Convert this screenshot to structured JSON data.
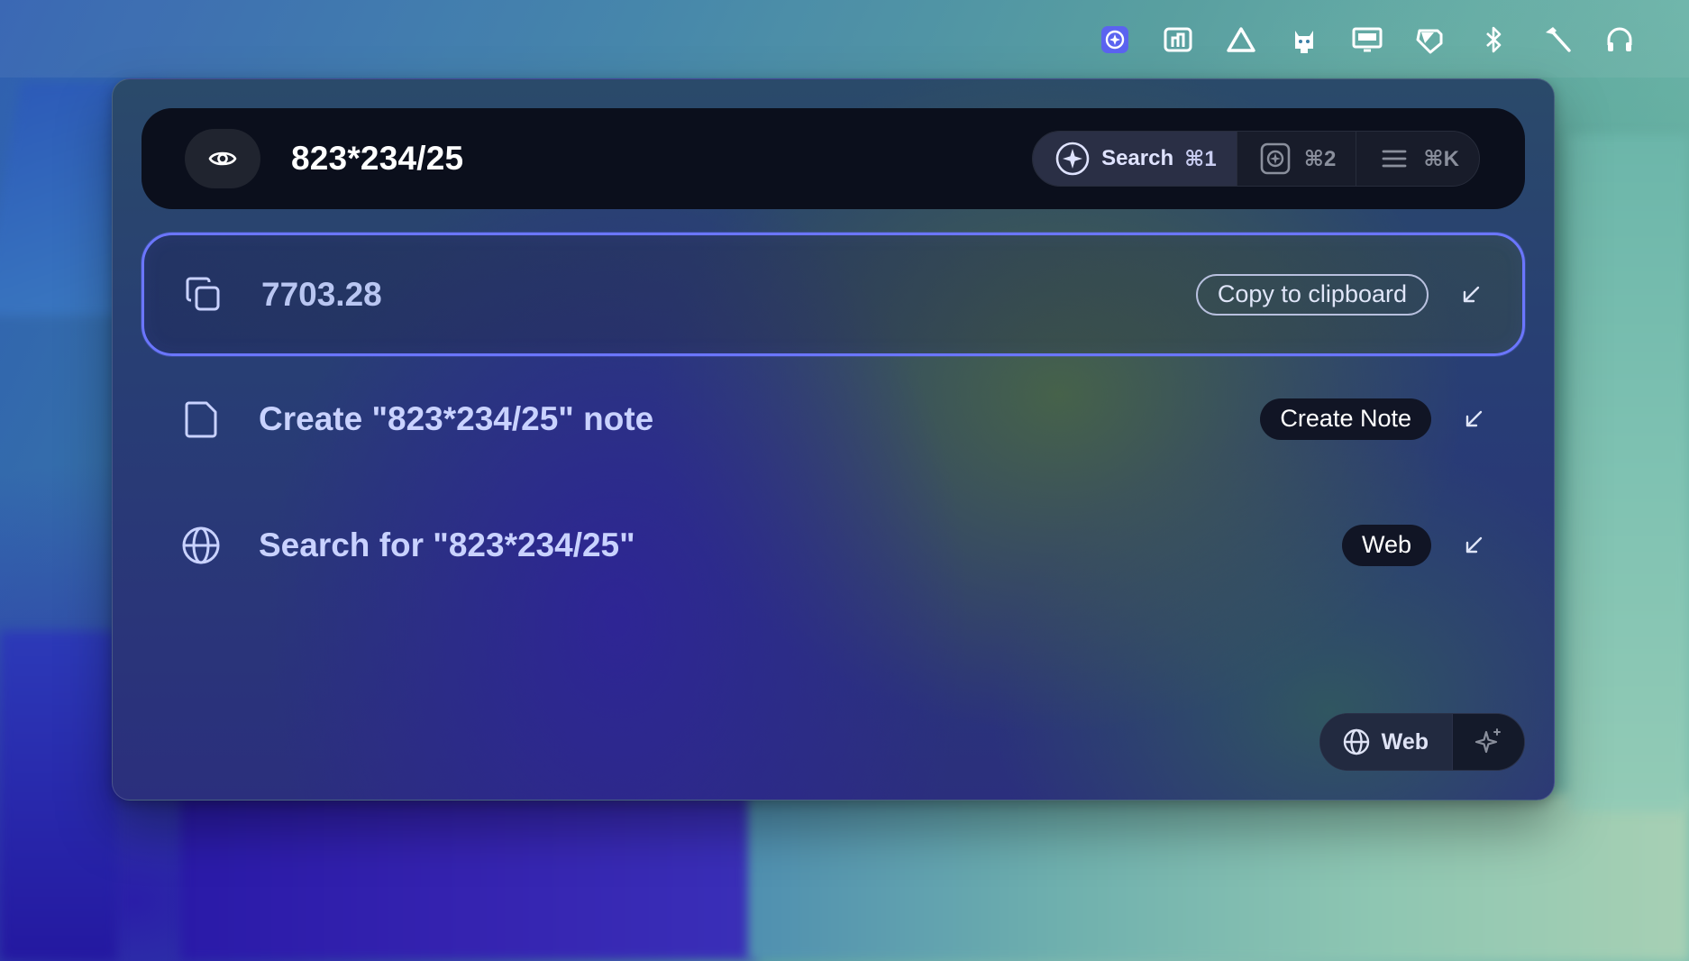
{
  "menubar": {
    "icons": [
      "raycast-icon",
      "presenter-icon",
      "drive-icon",
      "cat-bot-icon",
      "display-icon",
      "tag-icon",
      "bluetooth-icon",
      "hammer-icon",
      "headphones-icon"
    ]
  },
  "launcher": {
    "query": "823*234/25",
    "modes": [
      {
        "label": "Search",
        "shortcut": "⌘1",
        "icon": "sparkle-search-icon",
        "active": true
      },
      {
        "label": "",
        "shortcut": "⌘2",
        "icon": "ai-chat-icon",
        "active": false
      },
      {
        "label": "",
        "shortcut": "⌘K",
        "icon": "menu-lines-icon",
        "active": false
      }
    ],
    "results": [
      {
        "title": "7703.28",
        "action": "Copy to clipboard",
        "icon": "copy-icon",
        "selected": true
      },
      {
        "title": "Create \"823*234/25\" note",
        "action": "Create Note",
        "icon": "document-icon",
        "selected": false
      },
      {
        "title": "Search for \"823*234/25\"",
        "action": "Web",
        "icon": "globe-icon",
        "selected": false
      }
    ],
    "bottom": {
      "web_label": "Web"
    }
  },
  "colors": {
    "accent": "#6b76ff",
    "search_bar_bg": "#0b0f1c",
    "result_text": "#c9d2ff"
  }
}
